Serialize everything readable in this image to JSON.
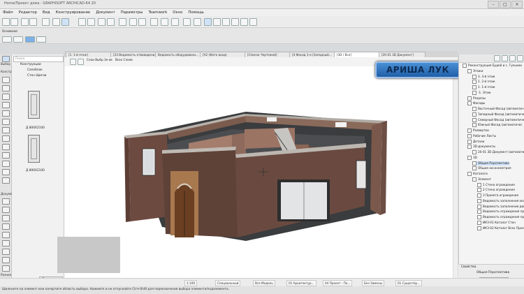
{
  "window": {
    "title": "Home/Проект дома - GRAPHISOFT ARCHICAD-64 20",
    "buttons": [
      "–",
      "□",
      "×"
    ]
  },
  "menu": [
    "Файл",
    "Редактор",
    "Вид",
    "Конструирование",
    "Документ",
    "Параметры",
    "Teamwork",
    "Окно",
    "Помощь"
  ],
  "toolbar": {
    "osnovnaya_label": "Основная"
  },
  "left_toolbox": {
    "label_vybor": "Выбор",
    "label_konstr": "Конструи",
    "label_document": "Документ",
    "label_raznoe": "Разное"
  },
  "browser": {
    "search_placeholder": "Поиск",
    "tree": [
      "Конструкции",
      "Сапоблок",
      "Стен Щигов"
    ],
    "doors": [
      "Д 800Х2100",
      "Д 800Х2100"
    ],
    "apply_label": "Применить"
  },
  "tabs": [
    "[1. 1-й этаж]",
    "[23 Ведомость отвоводени...",
    "Ведомость оборудовани...",
    "[A2 (Фото вход)",
    "[Список Чертежей]",
    "[4 Фасад 1-я (Западный...",
    "[3D / Все]",
    "[20-01 3D Документ]"
  ],
  "viewport_toolbar": {
    "layers_label": "Слои Выбр.3е-ов",
    "zoom_label": "Всех Слоев"
  },
  "overlay_logo": "АРИША ЛУК",
  "navigator": {
    "items": [
      {
        "label": "Реконструкция Будей и с. Гулькии",
        "level": 0,
        "sel": false
      },
      {
        "label": "Этажи",
        "level": 1,
        "sel": false
      },
      {
        "label": "3. 3-й этаж",
        "level": 2,
        "sel": false
      },
      {
        "label": "2. 2-й этаж",
        "level": 2,
        "sel": false
      },
      {
        "label": "1. 1-й этаж",
        "level": 2,
        "sel": false
      },
      {
        "label": "-1. Этаж",
        "level": 2,
        "sel": false
      },
      {
        "label": "Разрезы",
        "level": 1,
        "sel": false
      },
      {
        "label": "Фасады",
        "level": 1,
        "sel": false
      },
      {
        "label": "Восточный Фасад (автоматиче",
        "level": 2,
        "sel": false
      },
      {
        "label": "Западный Фасад (автоматиче",
        "level": 2,
        "sel": false
      },
      {
        "label": "Северный Фасад (автоматиче",
        "level": 2,
        "sel": false
      },
      {
        "label": "Южный Фасад (автоматичес",
        "level": 2,
        "sel": false
      },
      {
        "label": "Развертки",
        "level": 1,
        "sel": false
      },
      {
        "label": "Рабочие Листы",
        "level": 1,
        "sel": false
      },
      {
        "label": "Детали",
        "level": 1,
        "sel": false
      },
      {
        "label": "3D-документы",
        "level": 1,
        "sel": false
      },
      {
        "label": "20-01 3D Документ (автоматич",
        "level": 2,
        "sel": false
      },
      {
        "label": "3D",
        "level": 1,
        "sel": false
      },
      {
        "label": "Общая Перспектива",
        "level": 2,
        "sel": true
      },
      {
        "label": "Общая аксонометрия",
        "level": 2,
        "sel": false
      },
      {
        "label": "Каталоги",
        "level": 1,
        "sel": false
      },
      {
        "label": "Элемент",
        "level": 2,
        "sel": false
      },
      {
        "label": "1 Стена ограждения",
        "level": 3,
        "sel": false
      },
      {
        "label": "2 Стена ограждения",
        "level": 3,
        "sel": false
      },
      {
        "label": "3 Проекта ограждения",
        "level": 3,
        "sel": false
      },
      {
        "label": "Ведомость заполнения оконн",
        "level": 3,
        "sel": false
      },
      {
        "label": "Ведомость заполнения двере",
        "level": 3,
        "sel": false
      },
      {
        "label": "Ведомость ограждения про",
        "level": 3,
        "sel": false
      },
      {
        "label": "Ведомость ограждения про",
        "level": 3,
        "sel": false
      },
      {
        "label": "ИКЗ-01 Каталог Стен",
        "level": 3,
        "sel": false
      },
      {
        "label": "ИКЗ-02 Каталог Всех Проем",
        "level": 3,
        "sel": false
      }
    ]
  },
  "properties": {
    "header": "Свойства",
    "value": "Общая Перспектива",
    "button": "Параметры..."
  },
  "statusbar": [
    "1:100",
    "Специальный",
    "Вся Модель",
    "01 Архитектур...",
    "04 Проект - По...",
    "Без Замены",
    "01 Существу..."
  ],
  "hint": "Щелкните на элемент или начертите область выбора. Нажмите и не отпускайте Ctrl+Shift для переключения выбора элемента/подэлемента."
}
